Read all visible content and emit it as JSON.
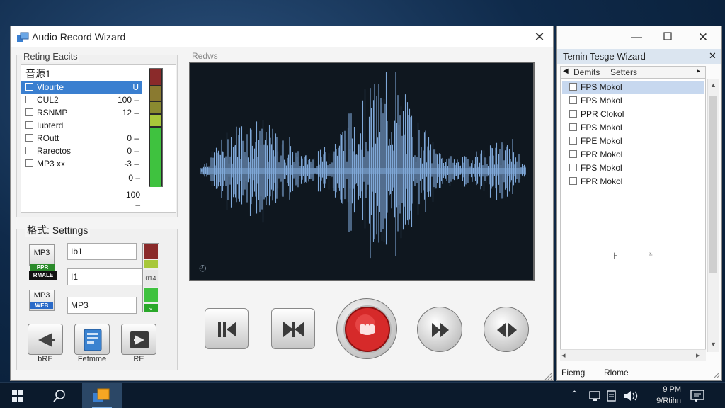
{
  "main_window": {
    "title": "Audio Record Wizard",
    "close_glyph": "✕"
  },
  "input_panel": {
    "group_label": "Reting Eacits",
    "header": "音源1",
    "items": [
      {
        "label": "Vlourte",
        "value": "U",
        "selected": true
      },
      {
        "label": "CUL2",
        "value": "100 –",
        "selected": false
      },
      {
        "label": "RSNMP",
        "value": "12 –",
        "selected": false
      },
      {
        "label": "Iubterd",
        "value": "",
        "selected": false
      },
      {
        "label": "ROutt",
        "value": "0 –",
        "selected": false
      },
      {
        "label": "Rarectos",
        "value": "0 –",
        "selected": false
      },
      {
        "label": "MP3 xx",
        "value": "-3 –",
        "selected": false
      }
    ],
    "extra_scale": [
      "0 –",
      "100 –"
    ]
  },
  "format_panel": {
    "label": "格式: Settings",
    "rows": [
      {
        "icon_text": "MP3",
        "tag": "PPR",
        "field": "Ib1"
      },
      {
        "icon_text": "RMALE",
        "tag": "",
        "field": "I1",
        "meter_text": "014"
      },
      {
        "icon_text": "MP3",
        "tag": "WEB",
        "field": "MP3"
      }
    ],
    "buttons": [
      {
        "label": "bRE",
        "icon": "back-arrow-icon"
      },
      {
        "label": "Fefmme",
        "icon": "document-icon"
      },
      {
        "label": "RE",
        "icon": "forward-box-icon"
      }
    ]
  },
  "preview": {
    "label": "Redws",
    "corner_glyph": "◴"
  },
  "transport": {
    "buttons": [
      "skip-back-icon",
      "skip-icon",
      "record-icon",
      "fast-forward-icon",
      "loop-icon"
    ]
  },
  "side_window": {
    "subtitle": "Temin Tesge Wizard",
    "tab_left": "◀",
    "tabs": [
      "Demits",
      "Setters"
    ],
    "tab_right": "▸",
    "items": [
      {
        "label": "FPS Mokol",
        "selected": true
      },
      {
        "label": "FPS Mokol",
        "selected": false
      },
      {
        "label": "PPR Clokol",
        "selected": false
      },
      {
        "label": "FPS Mokol",
        "selected": false
      },
      {
        "label": "FPE Mokol",
        "selected": false
      },
      {
        "label": "FPR Mokol",
        "selected": false
      },
      {
        "label": "FPS Mokol",
        "selected": false
      },
      {
        "label": "FPR Mokol",
        "selected": false
      }
    ],
    "footer": [
      "Fiemg",
      "Rlome"
    ],
    "scroll_left": "◂",
    "scroll_right": "▸"
  },
  "taskbar": {
    "clock_time": "9 PM",
    "clock_date": "9/Rtihn"
  },
  "colors": {
    "accent": "#3a7fd0",
    "wave": "#7fa8d8",
    "record": "#d62a2a",
    "meter_green": "#3fc23f",
    "meter_yellow": "#a8c83a",
    "meter_red": "#a82a2a"
  }
}
